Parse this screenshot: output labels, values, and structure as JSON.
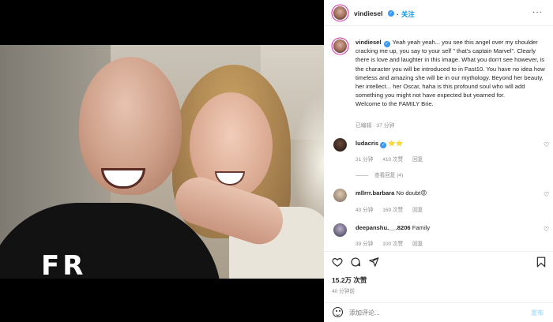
{
  "post": {
    "author": "vindiesel",
    "follow_label": "关注",
    "more_label": "···",
    "caption_author": "vindiesel",
    "caption_text": "Yeah yeah yeah... you see this angel over my shoulder cracking me up, you say to your self \" that's captain Marvel\". Clearly there is love and laughter in this image. What you don't see however, is the character you will be introduced to in Fast10. You have no idea how timeless and amazing she will be in our mythology. Beyond her beauty, her intellect... her Oscar, haha is this profound soul who will add something you might not have expected but yearned for.",
    "caption_line2": "Welcome to the FAMILY Brie.",
    "caption_meta": "已编辑 · 37 分钟",
    "shirt_print": "FR"
  },
  "comments": [
    {
      "user": "ludacris",
      "text": "⭐⭐",
      "time": "31 分钟",
      "likes": "410 次赞",
      "reply": "回复",
      "view_replies": "查看回复 (4)"
    },
    {
      "user": "mllrrr.barbara",
      "text": "No doubt😡",
      "time": "40 分钟",
      "likes": "169 次赞",
      "reply": "回复"
    },
    {
      "user": "deepanshu.__.8206",
      "text": "Family",
      "time": "39 分钟",
      "likes": "100 次赞",
      "reply": "回复"
    }
  ],
  "actions": {
    "likes_count": "15.2万 次赞",
    "time_ago": "40 分钟前"
  },
  "composer": {
    "placeholder": "添加评论...",
    "post_label": "发布"
  },
  "colors": {
    "link": "#0095f6",
    "meta": "#8e8e8e",
    "verified": "#3897f0"
  }
}
